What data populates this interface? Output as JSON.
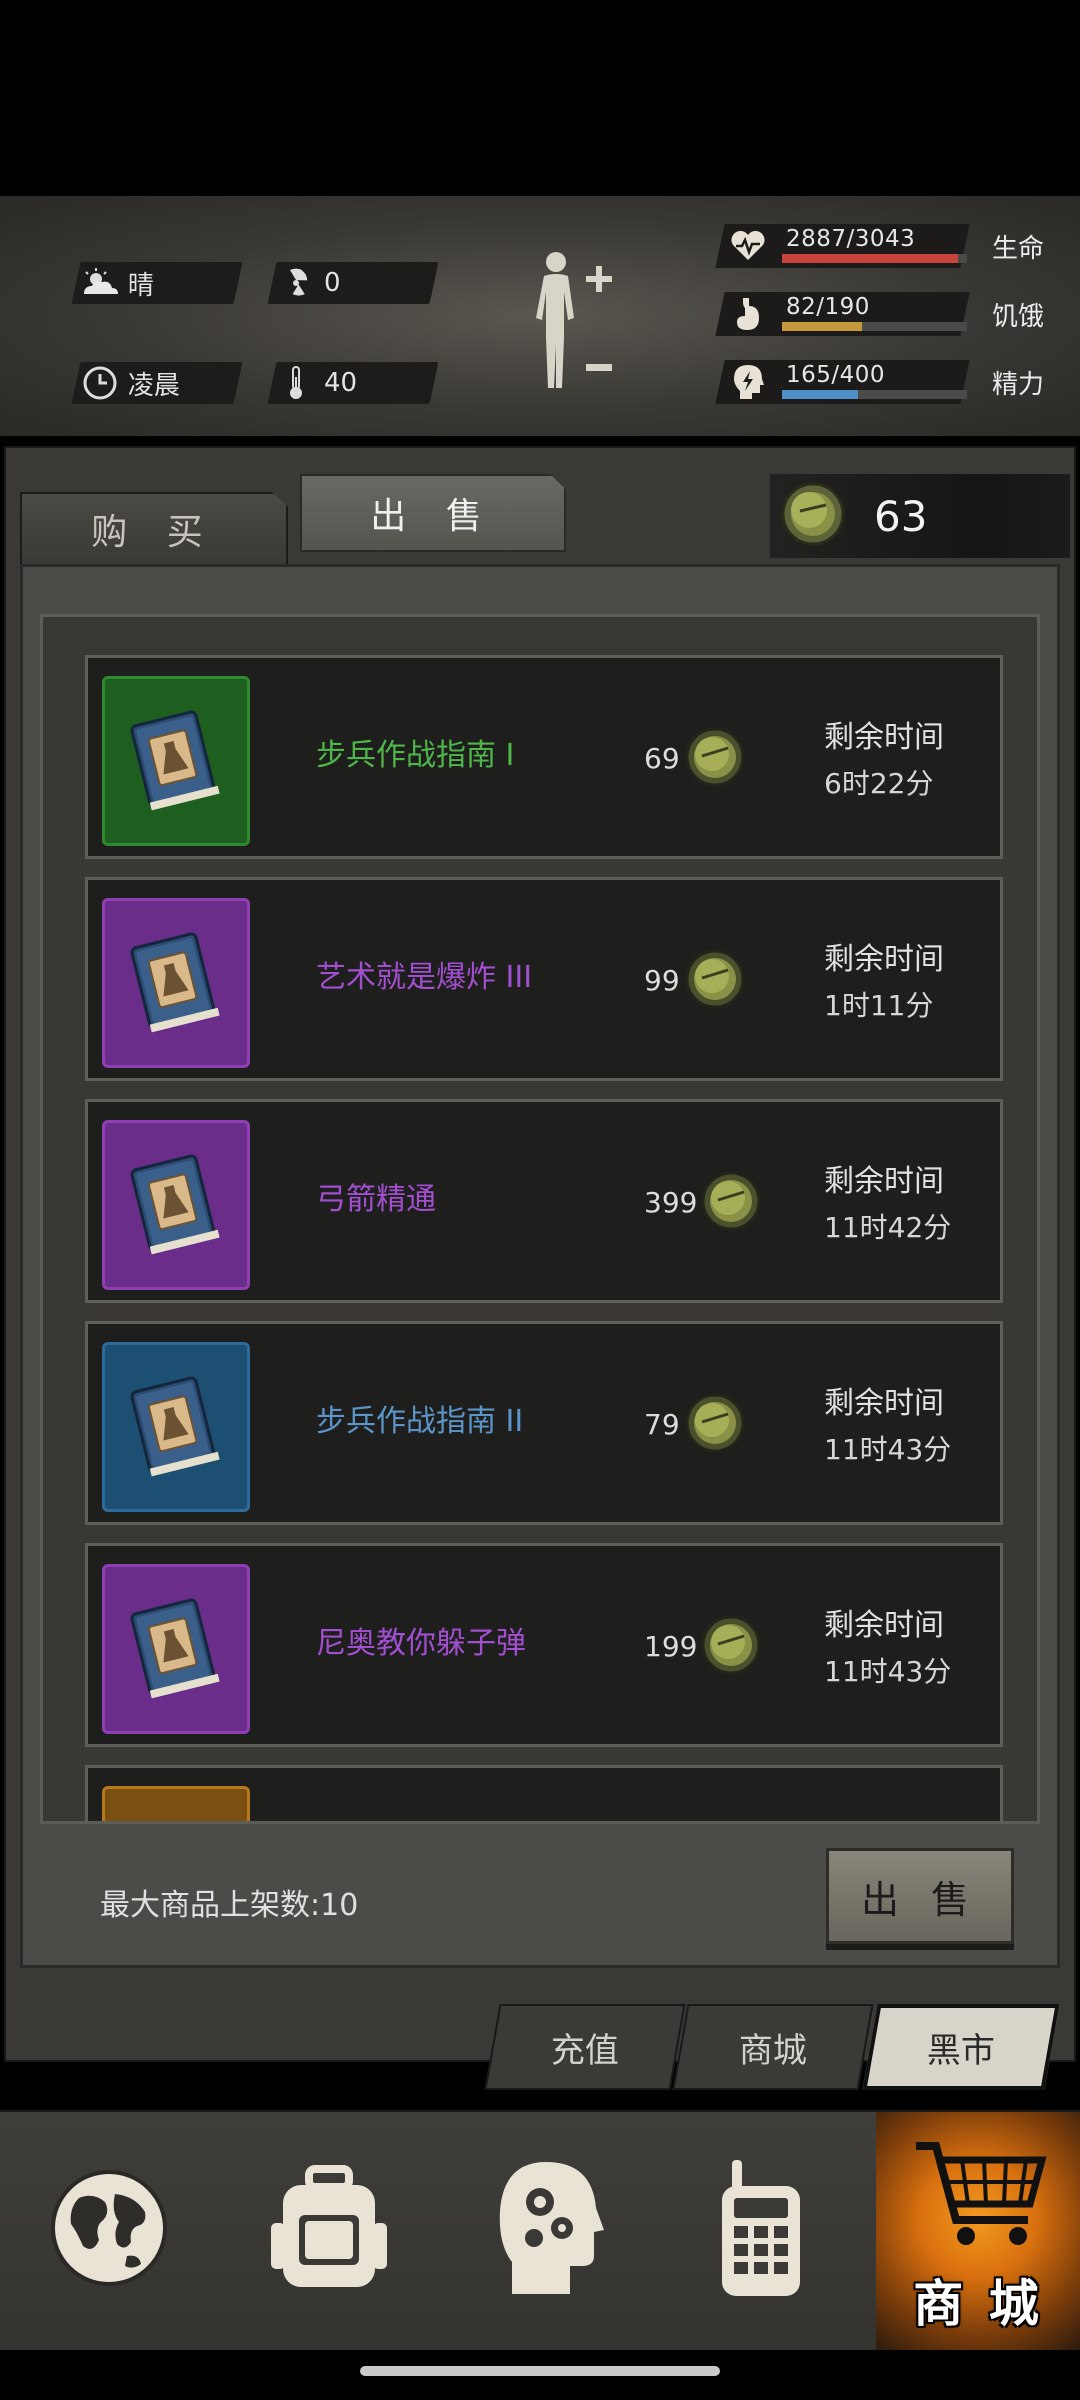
{
  "environment": {
    "weather": "晴",
    "radiation": "0",
    "time_of_day": "凌晨",
    "temperature": "40"
  },
  "stats": [
    {
      "label": "生命",
      "value": "2887/3043",
      "fraction": 0.949,
      "color": "#c9453b",
      "icon": "heart-pulse-icon"
    },
    {
      "label": "饥饿",
      "value": "82/190",
      "fraction": 0.432,
      "color": "#c69a3c",
      "icon": "stomach-icon"
    },
    {
      "label": "精力",
      "value": "165/400",
      "fraction": 0.4125,
      "color": "#4f8fc6",
      "icon": "head-bolt-icon"
    }
  ],
  "tabs": {
    "buy": "购 买",
    "sell": "出 售"
  },
  "coins": "63",
  "items": [
    {
      "name": "步兵作战指南 I",
      "price": "69",
      "remain_label": "剩余时间",
      "remain": "6时22分",
      "rarity_color": "#2f8a2f",
      "name_color": "#4fb74a",
      "bg": "#1e5e1f"
    },
    {
      "name": "艺术就是爆炸 III",
      "price": "99",
      "remain_label": "剩余时间",
      "remain": "1时11分",
      "rarity_color": "#8e3fb4",
      "name_color": "#a14fd0",
      "bg": "#6a2d8a"
    },
    {
      "name": "弓箭精通",
      "price": "399",
      "remain_label": "剩余时间",
      "remain": "11时42分",
      "rarity_color": "#8e3fb4",
      "name_color": "#a14fd0",
      "bg": "#6a2d8a"
    },
    {
      "name": "步兵作战指南 II",
      "price": "79",
      "remain_label": "剩余时间",
      "remain": "11时43分",
      "rarity_color": "#2d6b9a",
      "name_color": "#5b95c9",
      "bg": "#1d4f72"
    },
    {
      "name": "尼奥教你躲子弹",
      "price": "199",
      "remain_label": "剩余时间",
      "remain": "11时43分",
      "rarity_color": "#8e3fb4",
      "name_color": "#a14fd0",
      "bg": "#6a2d8a"
    }
  ],
  "footer": {
    "max_listing": "最大商品上架数:10",
    "sell_button": "出 售"
  },
  "subtabs": [
    "充值",
    "商城",
    "黑市"
  ],
  "bottom_nav": {
    "shop_label": "商 城"
  }
}
